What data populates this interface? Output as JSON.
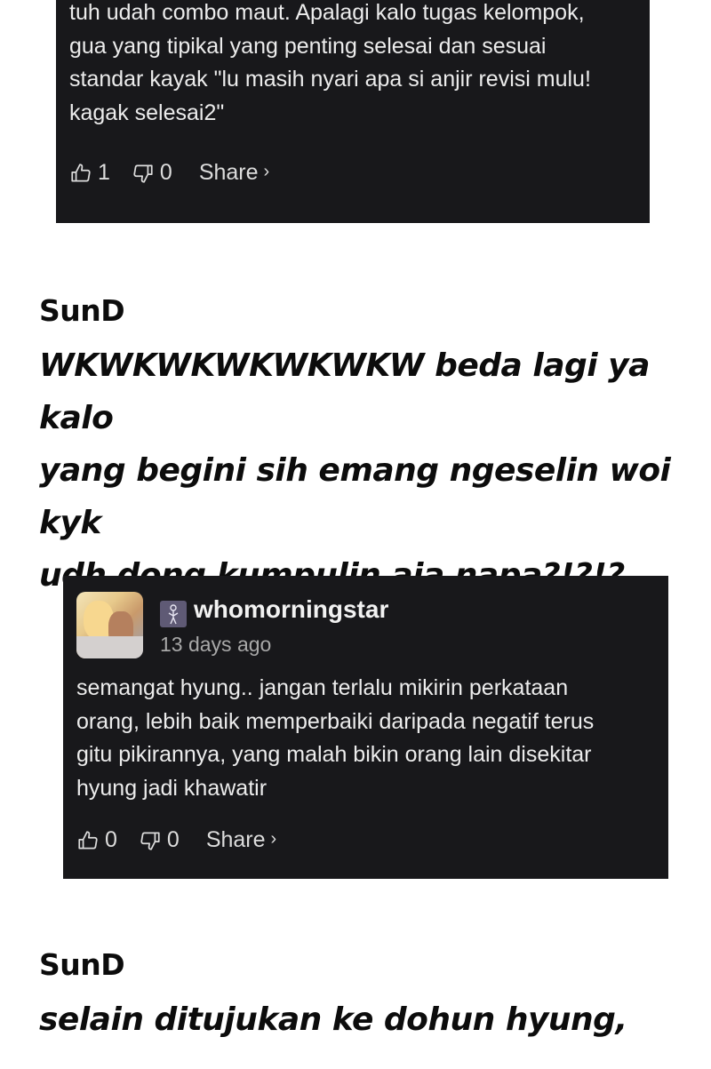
{
  "top_comment": {
    "text": "tuh udah combo maut. Apalagi kalo tugas kelompok,\ngua yang tipikal yang penting selesai dan sesuai\nstandar kayak \"lu masih nyari apa si anjir revisi mulu!\nkagak selesai2\"",
    "likes": "1",
    "dislikes": "0",
    "share_label": "Share",
    "share_chevron": "›"
  },
  "caption_1": {
    "author": "SunD",
    "text": "WKWKWKWKWKWKW beda lagi ya kalo\nyang begini sih emang ngeselin woi kyk\nudh dong kumpulin aja napa?!?!?"
  },
  "bottom_comment": {
    "username": "whomorningstar",
    "timestamp": "13 days ago",
    "text": "semangat hyung.. jangan terlalu mikirin perkataan\norang, lebih baik memperbaiki daripada negatif terus\ngitu pikirannya, yang malah bikin orang lain disekitar\nhyung jadi khawatir",
    "likes": "0",
    "dislikes": "0",
    "share_label": "Share",
    "share_chevron": "›"
  },
  "caption_2": {
    "author": "SunD",
    "text": "selain ditujukan ke dohun hyung,"
  },
  "icons": {
    "like": "thumbs-up-icon",
    "dislike": "thumbs-down-icon",
    "badge": "zodiac-badge-icon"
  },
  "colors": {
    "card_background": "#18181b",
    "card_text": "#ececec",
    "muted_text": "#a8a8a8",
    "page_background": "#ffffff"
  }
}
